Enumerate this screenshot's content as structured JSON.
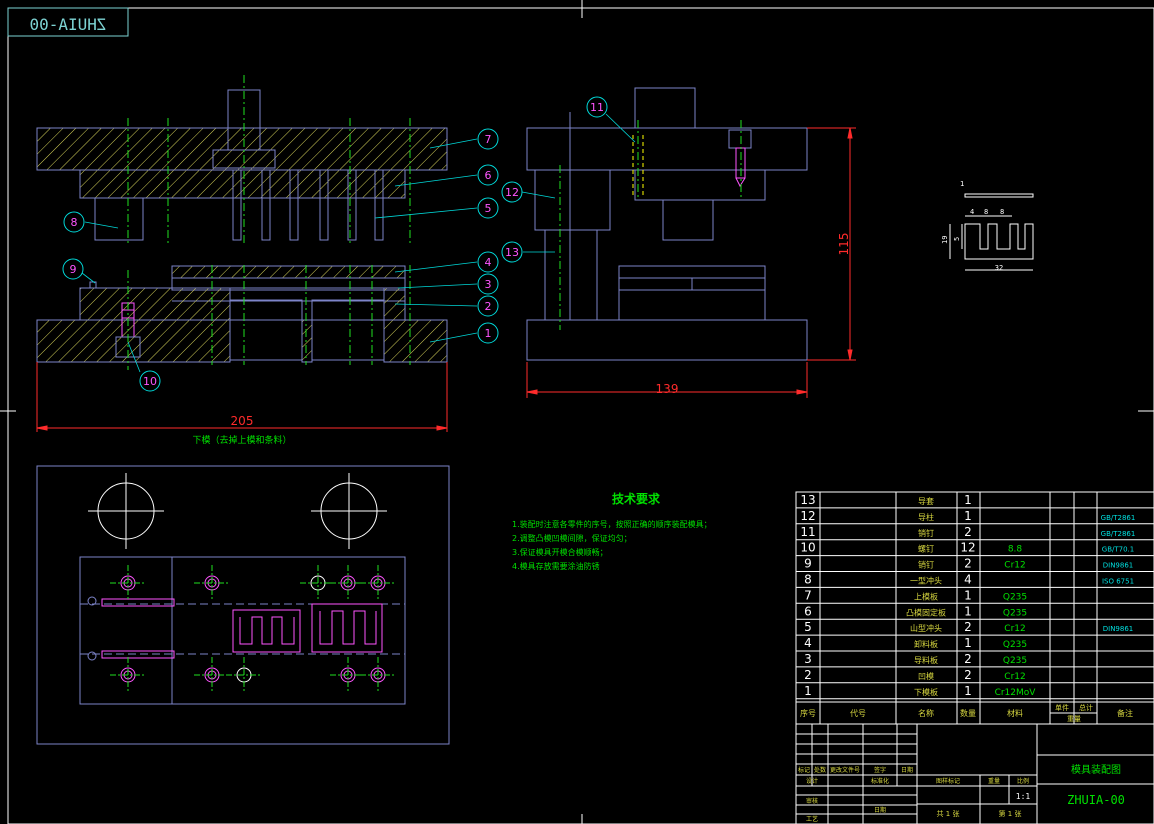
{
  "colors": {
    "background": "#000000",
    "frame": "#ffffff",
    "outline": "#7d84c9",
    "hatch": "#d6d35a",
    "centerline": "#1fe01f",
    "dimension": "#ff2b2b",
    "balloon": "#00d8d8",
    "balloon_text": "#ff55ff",
    "note_text": "#00e000",
    "table_line": "#ffffff",
    "part_text": "#d8d840",
    "material_text": "#00e000",
    "standard_text": "#00e0e0",
    "title_green": "#00e000"
  },
  "drawing": {
    "stamp_code": "ZHUIA-00",
    "dim_front_width": "205",
    "dim_side_width": "139",
    "dim_side_height": "115",
    "front_view_caption": "下模（去掉上模和条料）",
    "balloons": [
      "1",
      "2",
      "3",
      "4",
      "5",
      "6",
      "7",
      "8",
      "9",
      "10",
      "11",
      "12",
      "13"
    ],
    "part_dims": {
      "t": "1",
      "w1": "4",
      "w2": "8",
      "w3": "8",
      "h1": "19",
      "h2": "5",
      "total": "32"
    }
  },
  "notes": {
    "title": "技术要求",
    "items": [
      "1.装配时注意各零件的序号，按照正确的顺序装配模具；",
      "2.调整凸模凹模间隙，保证均匀；",
      "3.保证模具开模合模顺畅；",
      "4.模具存放需要涂油防锈"
    ]
  },
  "bom": {
    "rows": [
      {
        "no": "13",
        "name": "导套",
        "qty": "1",
        "material": "",
        "standard": ""
      },
      {
        "no": "12",
        "name": "导柱",
        "qty": "1",
        "material": "",
        "standard": "GB/T2861"
      },
      {
        "no": "11",
        "name": "销钉",
        "qty": "2",
        "material": "",
        "standard": "GB/T2861"
      },
      {
        "no": "10",
        "name": "螺钉",
        "qty": "12",
        "material": "8.8",
        "standard": "GB/T70.1"
      },
      {
        "no": "9",
        "name": "销钉",
        "qty": "2",
        "material": "Cr12",
        "standard": "DIN9861"
      },
      {
        "no": "8",
        "name": "一型冲头",
        "qty": "4",
        "material": "",
        "standard": "ISO 6751"
      },
      {
        "no": "7",
        "name": "上模板",
        "qty": "1",
        "material": "Q235",
        "standard": ""
      },
      {
        "no": "6",
        "name": "凸模固定板",
        "qty": "1",
        "material": "Q235",
        "standard": ""
      },
      {
        "no": "5",
        "name": "山型冲头",
        "qty": "2",
        "material": "Cr12",
        "standard": "DIN9861"
      },
      {
        "no": "4",
        "name": "卸料板",
        "qty": "1",
        "material": "Q235",
        "standard": ""
      },
      {
        "no": "3",
        "name": "导料板",
        "qty": "2",
        "material": "Q235",
        "standard": ""
      },
      {
        "no": "2",
        "name": "凹模",
        "qty": "2",
        "material": "Cr12",
        "standard": ""
      },
      {
        "no": "1",
        "name": "下模板",
        "qty": "1",
        "material": "Cr12MoV",
        "standard": ""
      }
    ],
    "headers": {
      "no": "序号",
      "code": "代号",
      "name": "名称",
      "qty": "数量",
      "material": "材料",
      "unit_weight": "单件",
      "total_weight": "总计",
      "weight": "重量",
      "remark": "备注"
    }
  },
  "title_block": {
    "drawing_title": "模具装配图",
    "drawing_code": "ZHUIA-00",
    "rev_headers": [
      "标记",
      "处数",
      "更改文件号",
      "签字",
      "日期"
    ],
    "sign_labels": [
      "设计",
      "标准化",
      "审核",
      "工艺",
      "日期"
    ],
    "stage_labels": [
      "图样标记",
      "重量",
      "比例"
    ],
    "scale": "1:1",
    "sheet_total": "共 1 张",
    "sheet_no": "第 1 张"
  }
}
